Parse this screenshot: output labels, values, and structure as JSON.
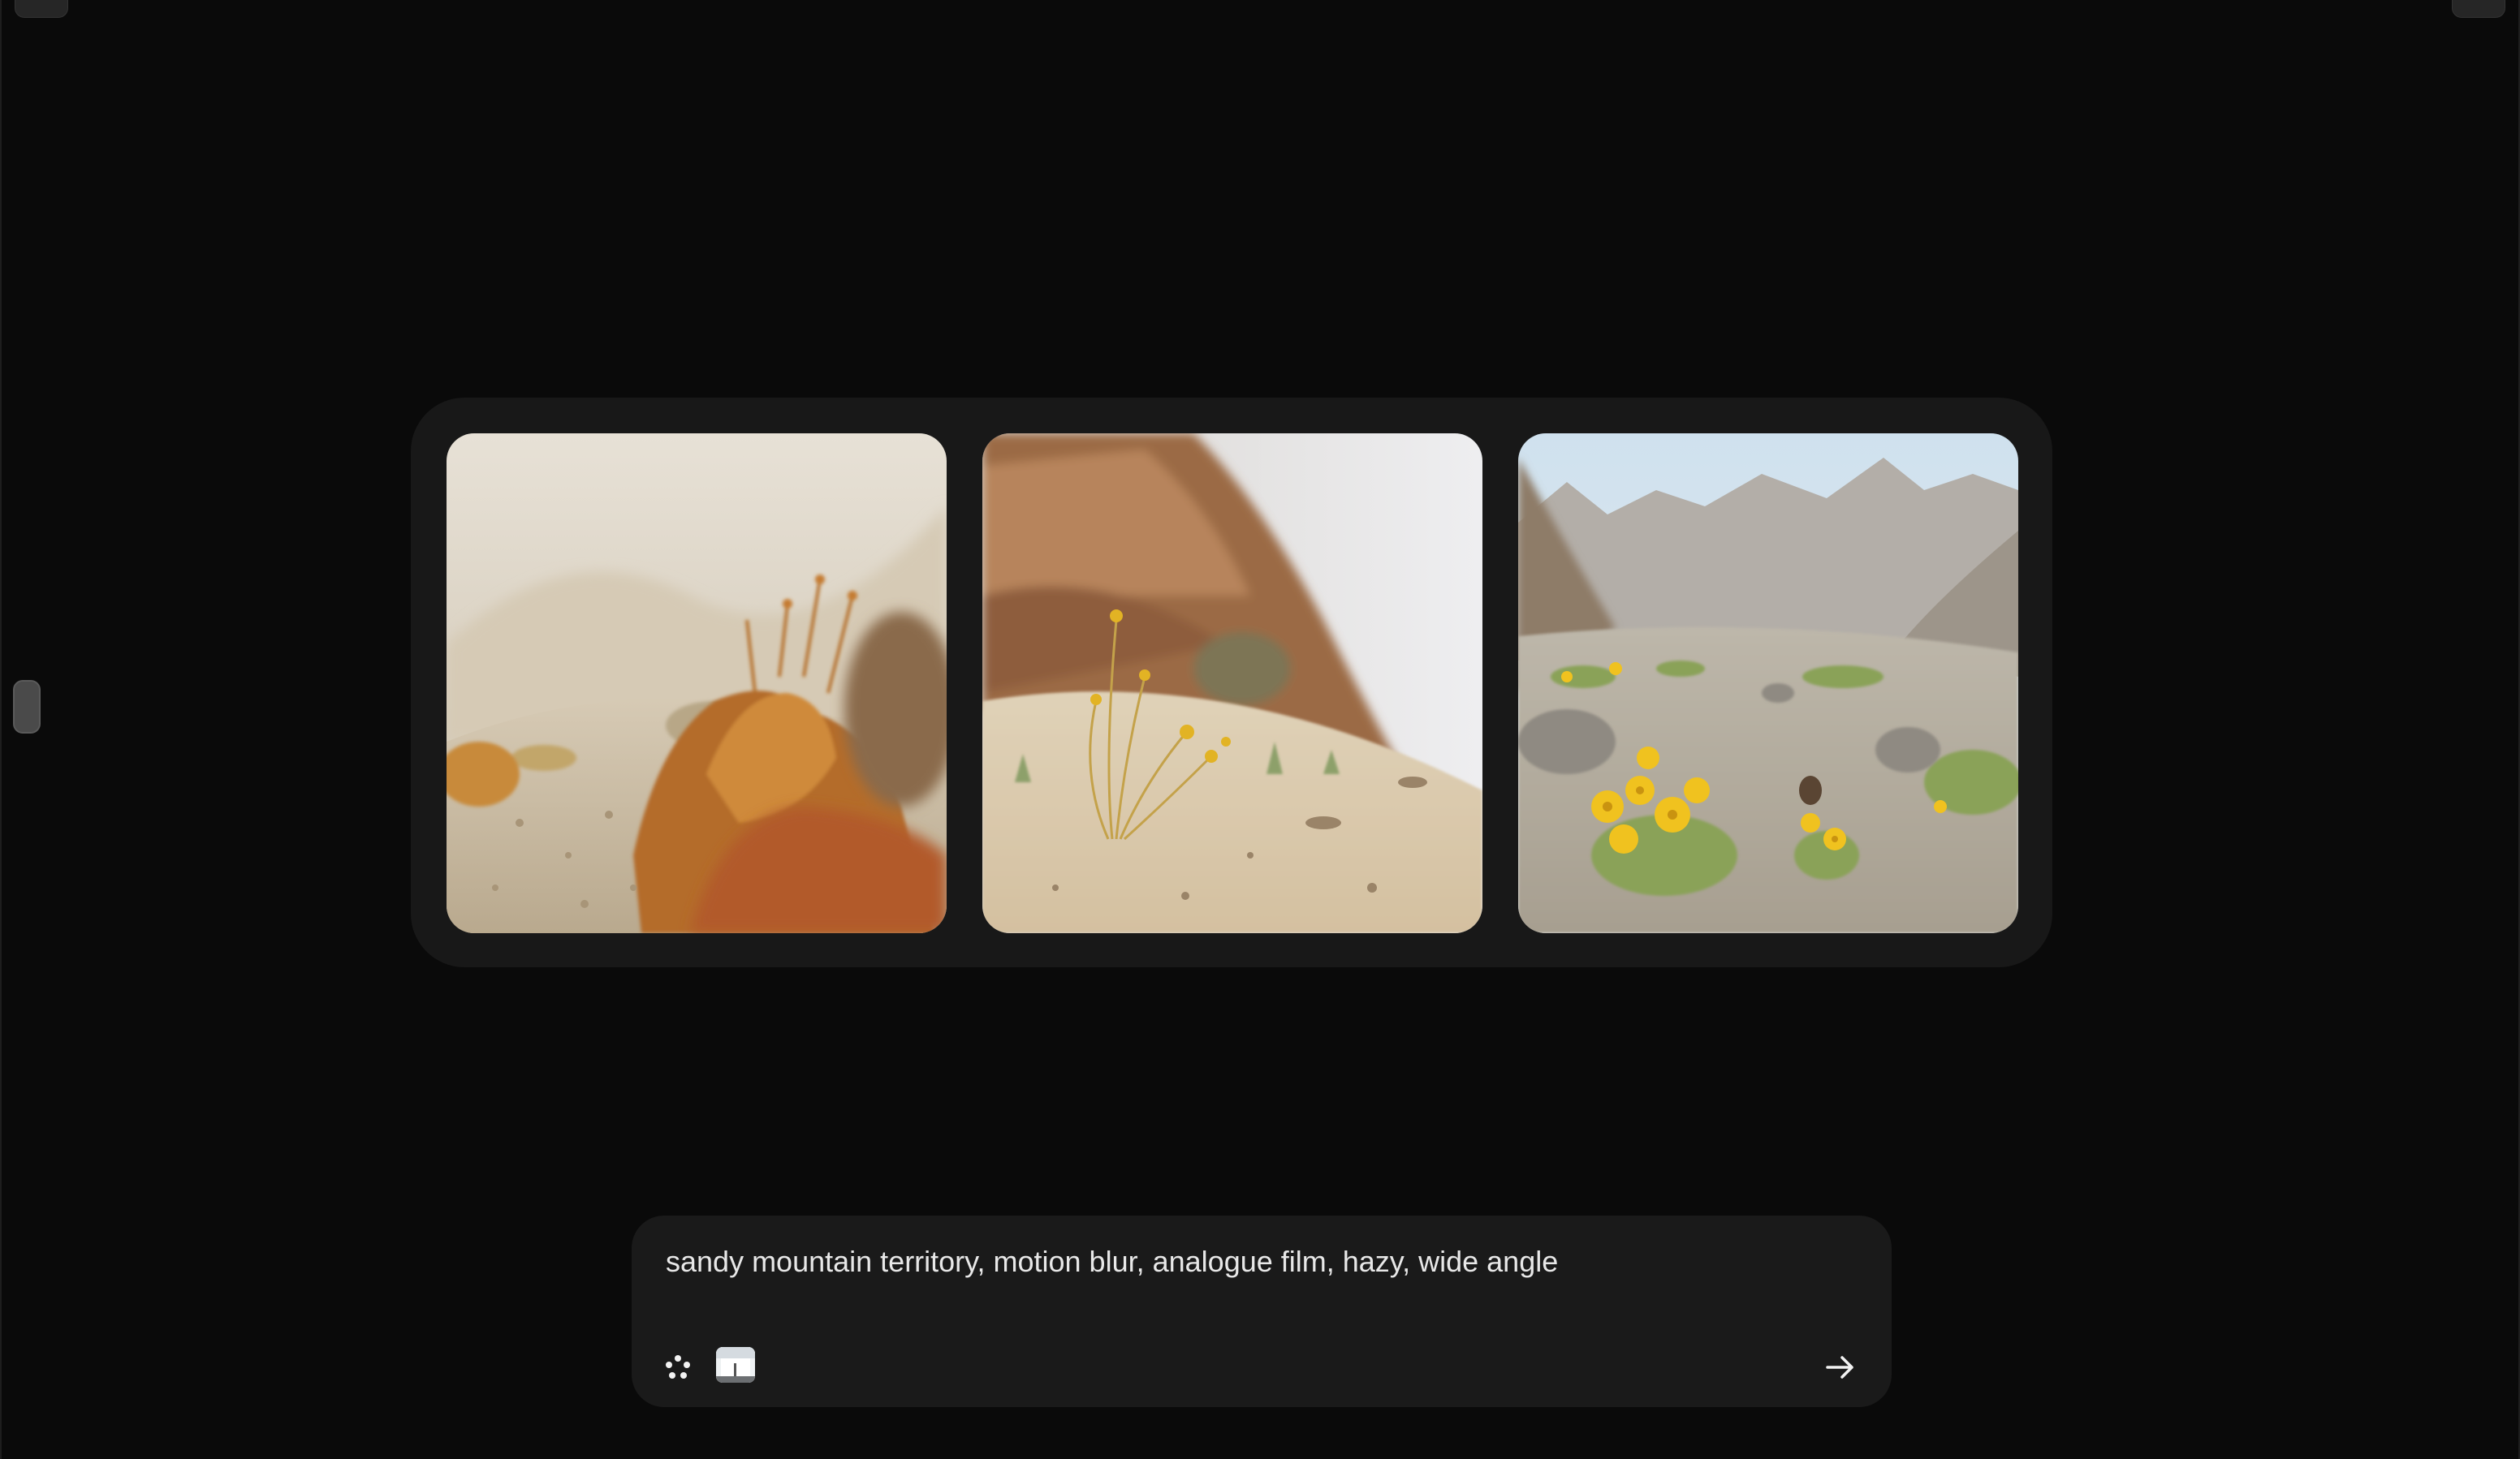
{
  "prompt": {
    "text": "sandy mountain territory, motion blur, analogue film, hazy, wide angle",
    "style_icon": "sparkle-dots-icon",
    "reference_icon": "image-reference-icon",
    "submit_icon": "arrow-right-icon"
  },
  "images": [
    {
      "name": "generated-image-1",
      "description_icon": "image"
    },
    {
      "name": "generated-image-2",
      "description_icon": "image"
    },
    {
      "name": "generated-image-3",
      "description_icon": "image"
    }
  ],
  "colors": {
    "background": "#0a0a0a",
    "tray": "#181818",
    "prompt_box": "#1a1a1a",
    "text": "#e8e8e8"
  }
}
